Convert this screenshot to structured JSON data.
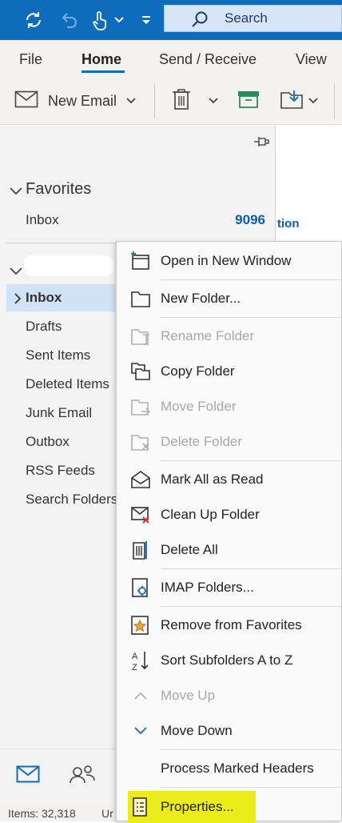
{
  "titlebar": {
    "search_label": "Search",
    "icons": [
      "sync-icon",
      "undo-icon",
      "touch-mode-icon",
      "chevron-down-icon",
      "quick-access-icon"
    ]
  },
  "tabs": [
    {
      "label": "File"
    },
    {
      "label": "Home"
    },
    {
      "label": "Send / Receive"
    },
    {
      "label": "View"
    }
  ],
  "ribbon": {
    "new_email_label": "New Email"
  },
  "nav": {
    "favorites_label": "Favorites",
    "favorites_inbox_label": "Inbox",
    "favorites_inbox_count": "9096",
    "account_folders": [
      {
        "label": "Inbox"
      },
      {
        "label": "Drafts"
      },
      {
        "label": "Sent Items"
      },
      {
        "label": "Deleted Items"
      },
      {
        "label": "Junk Email"
      },
      {
        "label": "Outbox"
      },
      {
        "label": "RSS Feeds"
      },
      {
        "label": "Search Folders"
      }
    ],
    "peek_text": "tion"
  },
  "status": {
    "items_text": "Items: 32,318",
    "unread_prefix": "Ur"
  },
  "menu": {
    "items": [
      {
        "label": "Open in New Window",
        "disabled": false
      },
      {
        "label": "New Folder...",
        "disabled": false
      },
      {
        "label": "Rename Folder",
        "disabled": true
      },
      {
        "label": "Copy Folder",
        "disabled": false
      },
      {
        "label": "Move Folder",
        "disabled": true
      },
      {
        "label": "Delete Folder",
        "disabled": true
      },
      {
        "label": "Mark All as Read",
        "disabled": false
      },
      {
        "label": "Clean Up Folder",
        "disabled": false
      },
      {
        "label": "Delete All",
        "disabled": false
      },
      {
        "label": "IMAP Folders...",
        "disabled": false
      },
      {
        "label": "Remove from Favorites",
        "disabled": false
      },
      {
        "label": "Sort Subfolders A to Z",
        "disabled": false
      },
      {
        "label": "Move Up",
        "disabled": true
      },
      {
        "label": "Move Down",
        "disabled": false
      },
      {
        "label": "Process Marked Headers",
        "disabled": false
      },
      {
        "label": "Properties...",
        "disabled": false,
        "highlighted": true
      }
    ]
  },
  "colors": {
    "brand": "#0F6CBD",
    "count": "#0F5BB0",
    "highlight": "#ECEC1A",
    "selection": "#CFE2F6"
  }
}
